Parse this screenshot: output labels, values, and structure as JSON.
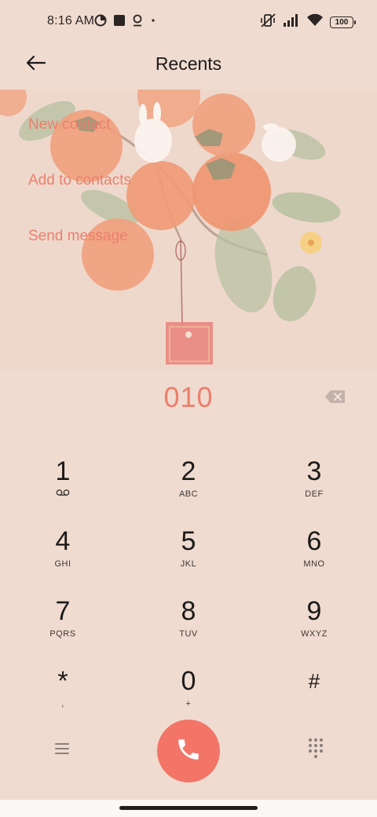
{
  "status_bar": {
    "time": "8:16 AM",
    "battery": "100",
    "icons": [
      "data-saver-icon",
      "square-app-icon",
      "location-pin-icon",
      "dot-icon",
      "vibrate-off-icon",
      "signal-icon",
      "wifi-icon",
      "battery-icon"
    ]
  },
  "header": {
    "title": "Recents",
    "back_icon": "arrow-left-icon"
  },
  "actions": {
    "new_contact": "New contact",
    "add_to_contacts": "Add to contacts",
    "send_message": "Send message"
  },
  "dialer": {
    "number": "010",
    "backspace_icon": "backspace-icon"
  },
  "keypad": {
    "keys": [
      {
        "digit": "1",
        "letters": ""
      },
      {
        "digit": "2",
        "letters": "ABC"
      },
      {
        "digit": "3",
        "letters": "DEF"
      },
      {
        "digit": "4",
        "letters": "GHI"
      },
      {
        "digit": "5",
        "letters": "JKL"
      },
      {
        "digit": "6",
        "letters": "MNO"
      },
      {
        "digit": "7",
        "letters": "PQRS"
      },
      {
        "digit": "8",
        "letters": "TUV"
      },
      {
        "digit": "9",
        "letters": "WXYZ"
      },
      {
        "digit": "*",
        "letters": ","
      },
      {
        "digit": "0",
        "letters": "+"
      },
      {
        "digit": "#",
        "letters": ""
      }
    ]
  },
  "bottom_bar": {
    "menu_icon": "menu-icon",
    "call_icon": "phone-icon",
    "dialpad_icon": "dialpad-icon"
  },
  "colors": {
    "background": "#efdbd0",
    "accent": "#ec7f6c",
    "call_button": "#f27568"
  }
}
